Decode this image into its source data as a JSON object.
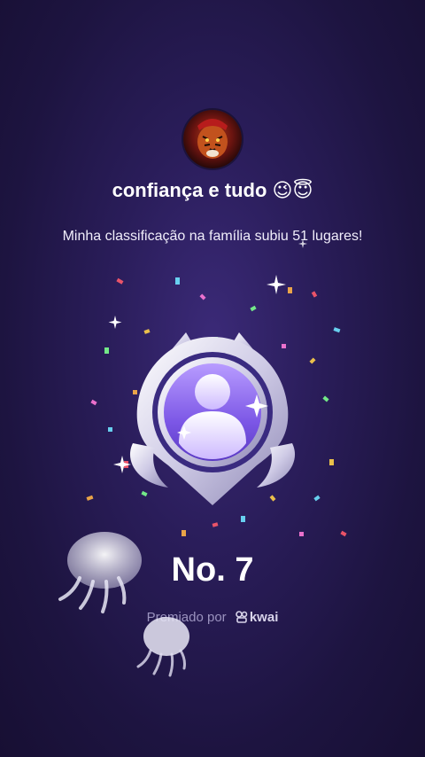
{
  "profile": {
    "username": "confiança e tudo 😉😇"
  },
  "message": "Minha classificação na família subiu 51 lugares!",
  "rank_label": "No. 7",
  "awarded": {
    "prefix": "Premiado por",
    "brand": "kwai"
  },
  "colors": {
    "background": "#241a4e",
    "badge_purple": "#8f6cf0",
    "badge_silver": "#e6e4f2",
    "subtle_text": "#9b93bf"
  },
  "icons": [
    "avatar-image",
    "family-rank-badge-icon",
    "kwai-logo-icon",
    "jellyfish-sticker",
    "sparkle-icon"
  ]
}
